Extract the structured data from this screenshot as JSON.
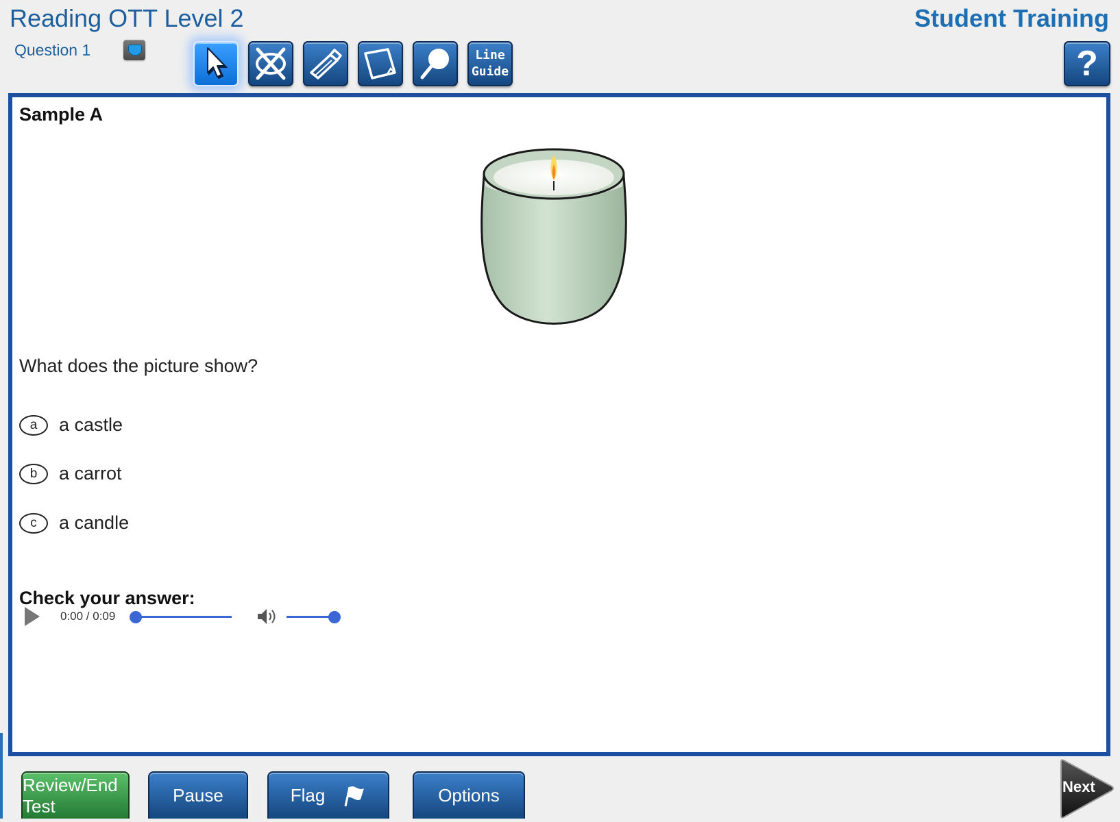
{
  "header": {
    "title": "Reading OTT Level 2",
    "question_label": "Question 1",
    "brand": "Student Training",
    "help_label": "?"
  },
  "toolbar": {
    "line_guide_line1": "Line",
    "line_guide_line2": "Guide",
    "active_tool": "pointer"
  },
  "content": {
    "sample_title": "Sample A",
    "question": "What does the picture show?",
    "choices": [
      {
        "letter": "a",
        "text": "a castle"
      },
      {
        "letter": "b",
        "text": "a carrot"
      },
      {
        "letter": "c",
        "text": "a candle"
      }
    ],
    "check_title": "Check your answer:",
    "audio": {
      "time": "0:00 / 0:09",
      "progress": 0.0,
      "volume": 1.0
    }
  },
  "footer": {
    "review_label": "Review/End Test",
    "pause_label": "Pause",
    "flag_label": "Flag",
    "options_label": "Options",
    "next_label": "Next"
  },
  "colors": {
    "panel_border": "#1d4fa0",
    "title_blue": "#1d5f9e",
    "button_blue": "#14467f",
    "review_green": "#237a34",
    "slider_blue": "#3b67d6"
  }
}
